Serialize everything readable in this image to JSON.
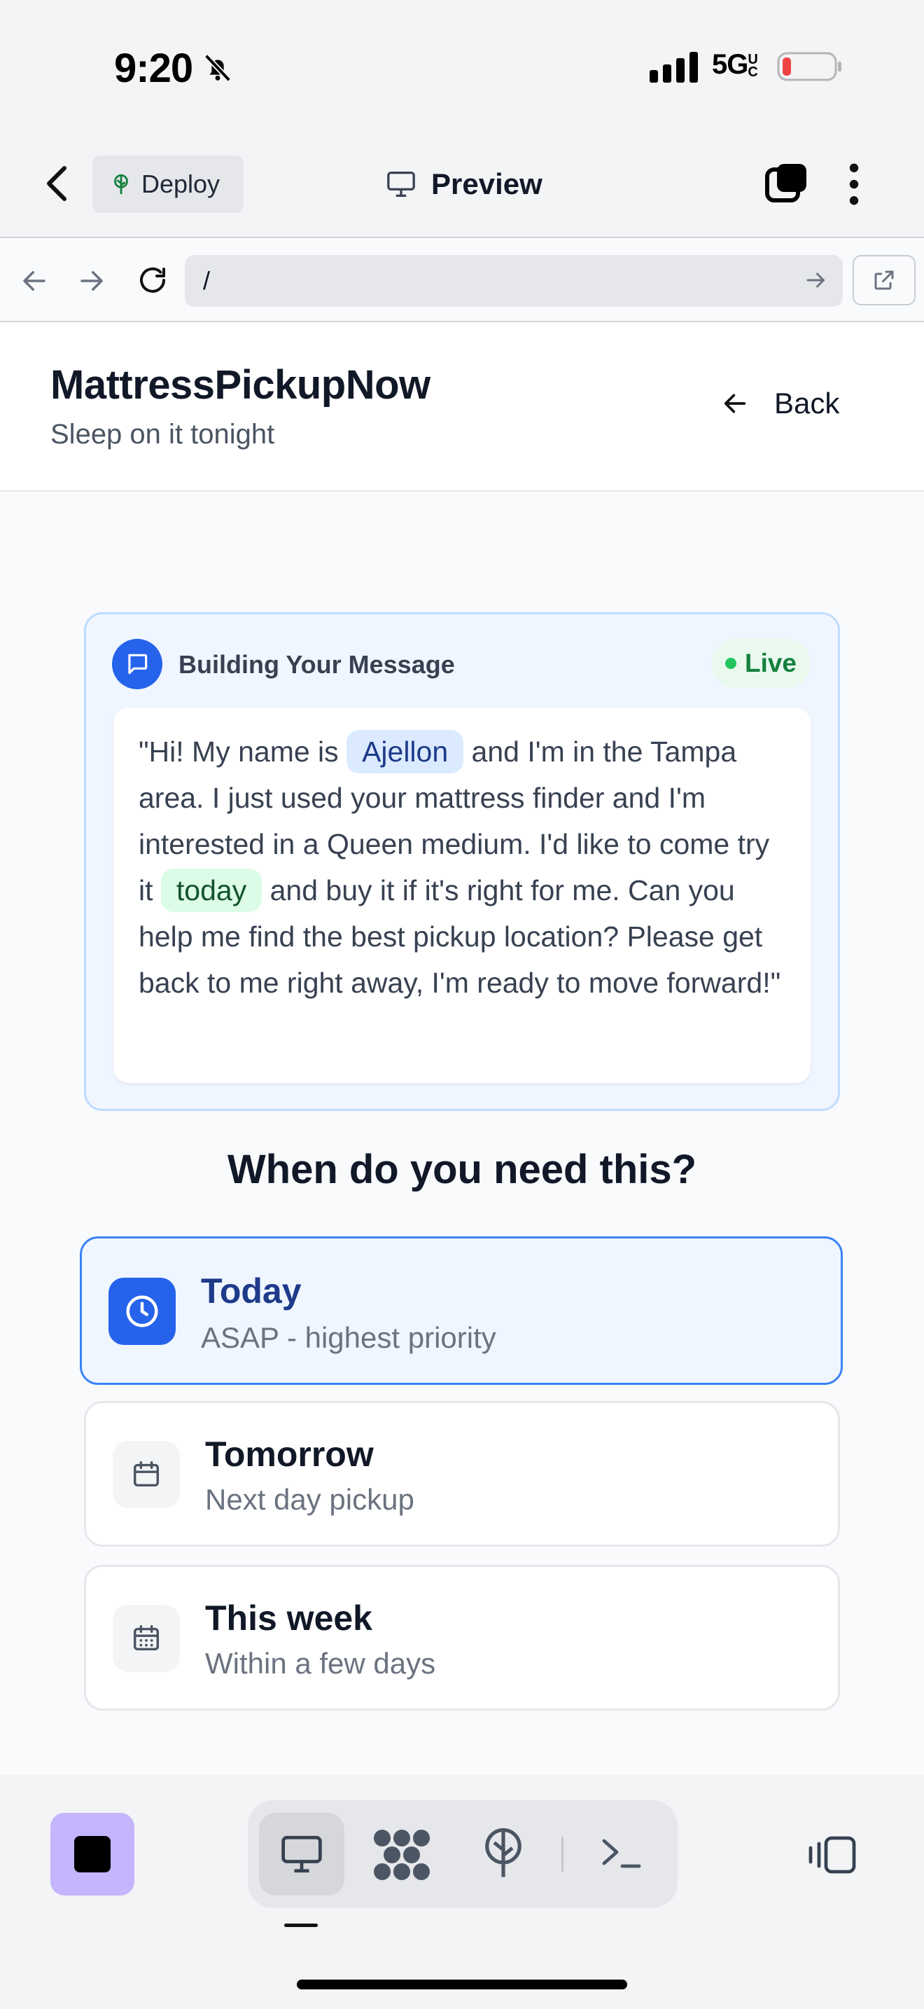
{
  "status_bar": {
    "time": "9:20",
    "network": "5G",
    "network_suffix": "UC"
  },
  "app_bar": {
    "deploy_label": "Deploy",
    "preview_label": "Preview"
  },
  "browser": {
    "url": "/"
  },
  "site": {
    "brand": "MattressPickupNow",
    "tagline": "Sleep on it tonight",
    "back_label": "Back"
  },
  "message_card": {
    "title": "Building Your Message",
    "live_label": "Live",
    "text_1": "\"Hi! My name is ",
    "name_chip": "Ajellon",
    "text_2": " and I'm in the Tampa area. I just used your mattress finder and I'm interested in a Queen medium. I'd like to come try it ",
    "time_chip": "today",
    "text_3": " and buy it if it's right for me. Can you help me find the best pickup location? Please get back to me right away, I'm ready to move forward!\""
  },
  "question": "When do you need this?",
  "options": [
    {
      "title": "Today",
      "subtitle": "ASAP - highest priority",
      "icon": "clock-icon",
      "selected": true
    },
    {
      "title": "Tomorrow",
      "subtitle": "Next day pickup",
      "icon": "calendar-icon",
      "selected": false
    },
    {
      "title": "This week",
      "subtitle": "Within a few days",
      "icon": "calendar-days-icon",
      "selected": false
    }
  ],
  "colors": {
    "accent": "#2563eb",
    "live_green": "#22c55e",
    "stop_purple": "#c4b5fd"
  }
}
